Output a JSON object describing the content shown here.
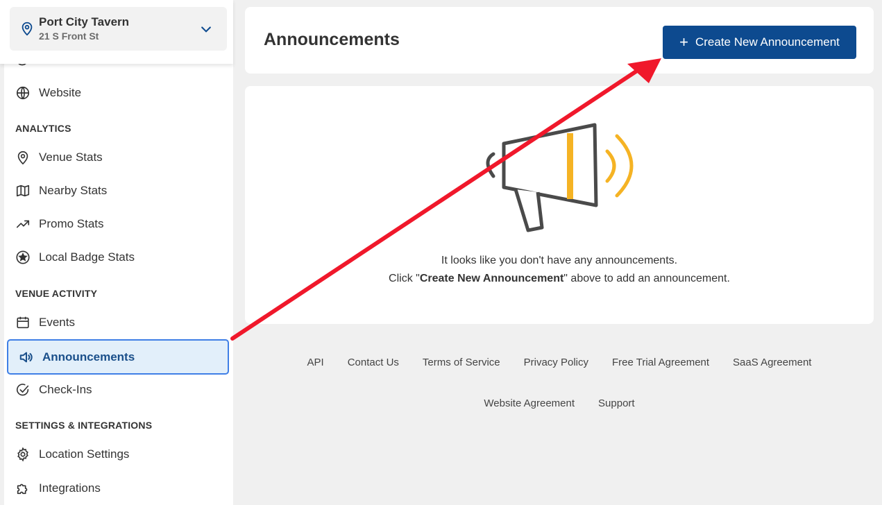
{
  "location": {
    "name": "Port City Tavern",
    "address": "21 S Front St"
  },
  "sidebar": {
    "website_label": "Website",
    "sections": {
      "analytics": "ANALYTICS",
      "venue_activity": "VENUE ACTIVITY",
      "settings": "SETTINGS & INTEGRATIONS"
    },
    "items": {
      "venue_stats": "Venue Stats",
      "nearby_stats": "Nearby Stats",
      "promo_stats": "Promo Stats",
      "local_badge_stats": "Local Badge Stats",
      "events": "Events",
      "announcements": "Announcements",
      "check_ins": "Check-Ins",
      "location_settings": "Location Settings",
      "integrations": "Integrations"
    }
  },
  "main": {
    "title": "Announcements",
    "create_button": "Create New Announcement",
    "empty_line1": "It looks like you don't have any announcements.",
    "empty_line2_prefix": "Click \"",
    "empty_line2_bold": "Create New Announcement",
    "empty_line2_suffix": "\" above to add an announcement."
  },
  "footer": {
    "links_row1": [
      "API",
      "Contact Us",
      "Terms of Service",
      "Privacy Policy",
      "Free Trial Agreement",
      "SaaS Agreement"
    ],
    "links_row2": [
      "Website Agreement",
      "Support"
    ]
  },
  "colors": {
    "accent_blue": "#0d4a8f",
    "active_border": "#3f7fe6",
    "active_bg": "#e2effa",
    "megaphone_yellow": "#f5b324",
    "annotation_arrow": "#f0182b"
  }
}
